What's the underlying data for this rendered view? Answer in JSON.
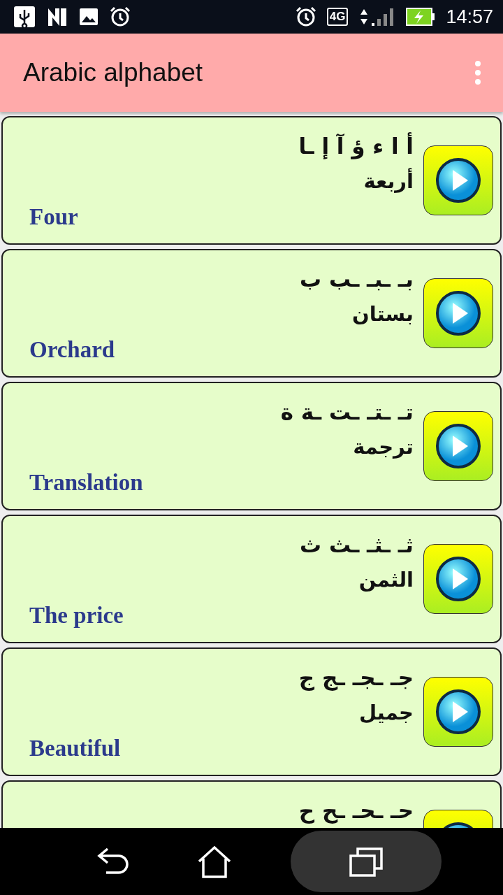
{
  "status_bar": {
    "network": "4G",
    "time": "14:57"
  },
  "app_bar": {
    "title": "Arabic alphabet"
  },
  "cards": [
    {
      "letters": "أ ا ء ؤ آ إ ـا",
      "word": "أربعة",
      "translation": "Four"
    },
    {
      "letters": "بـ ـبـ ـب ب",
      "word": "بستان",
      "translation": "Orchard"
    },
    {
      "letters": "تـ ـتـ ـت ـة ة",
      "word": "ترجمة",
      "translation": "Translation"
    },
    {
      "letters": "ثـ ـثـ ـث ث",
      "word": "الثمن",
      "translation": "The price"
    },
    {
      "letters": "جـ ـجـ ـج ج",
      "word": "جميل",
      "translation": "Beautiful"
    },
    {
      "letters": "حـ ـحـ ـح ح"
    }
  ]
}
